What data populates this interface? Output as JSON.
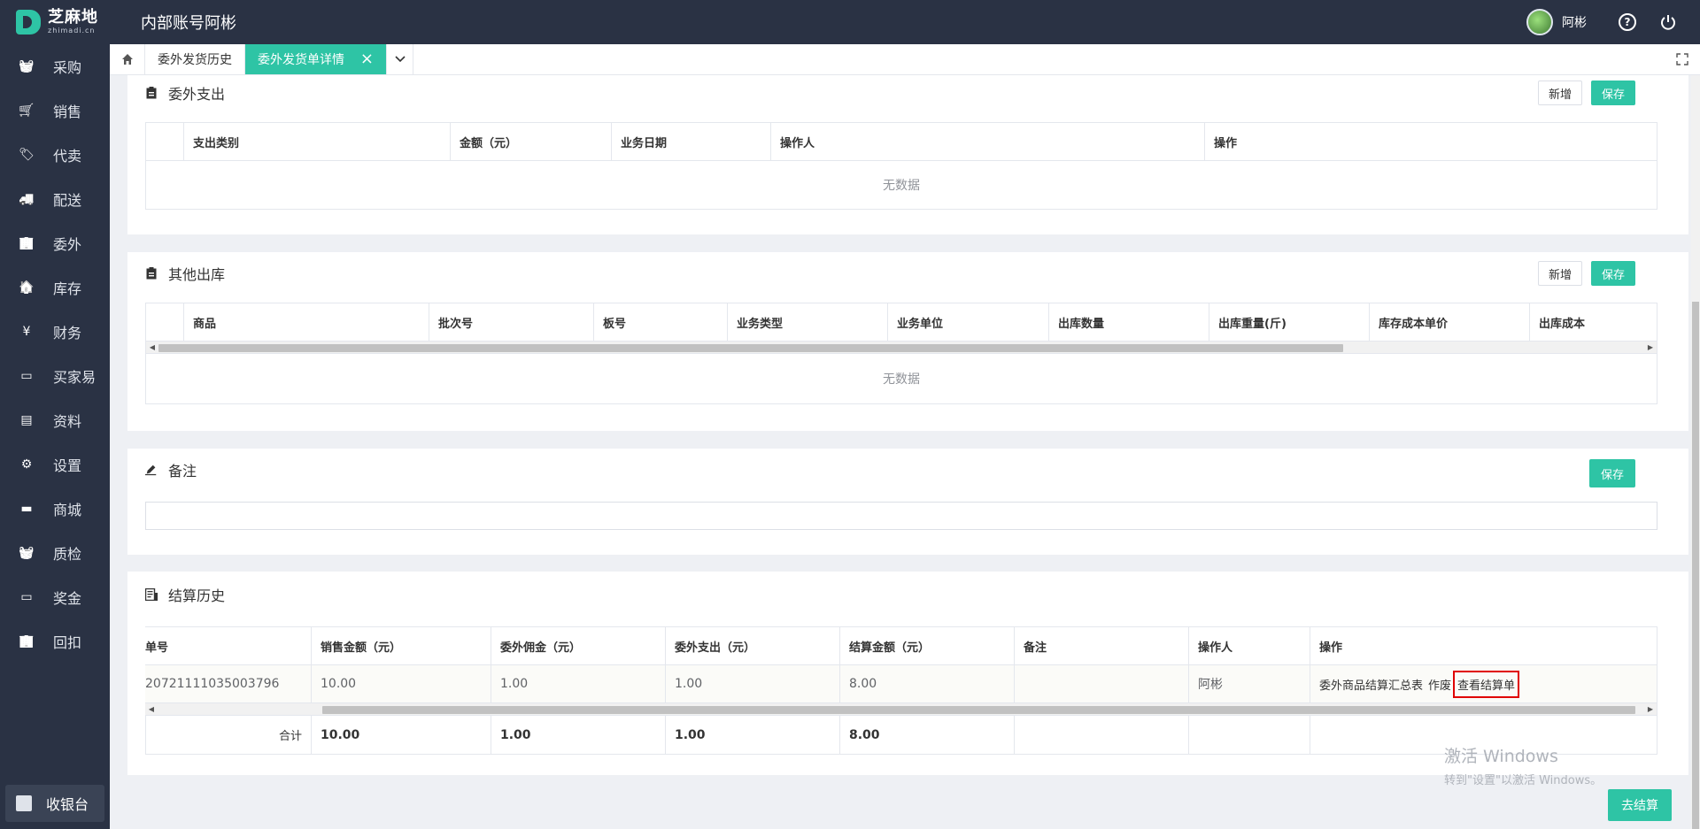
{
  "header": {
    "brand_cn": "芝麻地",
    "brand_en": "zhimadi.cn",
    "app_title": "内部账号阿彬",
    "username": "阿彬"
  },
  "sidebar": {
    "items": [
      {
        "label": "采购",
        "icon": "basket-icon"
      },
      {
        "label": "销售",
        "icon": "cart-icon"
      },
      {
        "label": "代卖",
        "icon": "tag-icon"
      },
      {
        "label": "配送",
        "icon": "truck-icon"
      },
      {
        "label": "委外",
        "icon": "building-icon"
      },
      {
        "label": "库存",
        "icon": "warehouse-icon"
      },
      {
        "label": "财务",
        "icon": "yen-icon"
      },
      {
        "label": "买家易",
        "icon": "store-icon"
      },
      {
        "label": "资料",
        "icon": "printer-icon"
      },
      {
        "label": "设置",
        "icon": "gear-icon"
      },
      {
        "label": "商城",
        "icon": "shop-icon"
      },
      {
        "label": "质检",
        "icon": "basket-check-icon"
      },
      {
        "label": "奖金",
        "icon": "wallet-icon"
      },
      {
        "label": "回扣",
        "icon": "building-return-icon"
      }
    ],
    "cashier": "收银台"
  },
  "tabs": {
    "items": [
      "委外发货历史",
      "委外发货单详情"
    ],
    "active_index": 1
  },
  "outsourcing_expense": {
    "title": "委外支出",
    "add_label": "新增",
    "save_label": "保存",
    "columns": [
      "",
      "支出类别",
      "金额（元）",
      "业务日期",
      "操作人",
      "操作"
    ],
    "empty_text": "无数据"
  },
  "other_outbound": {
    "title": "其他出库",
    "add_label": "新增",
    "save_label": "保存",
    "columns": [
      "",
      "商品",
      "批次号",
      "板号",
      "业务类型",
      "业务单位",
      "出库数量",
      "出库重量(斤)",
      "库存成本单价",
      "出库成本"
    ],
    "empty_text": "无数据"
  },
  "remark": {
    "title": "备注",
    "save_label": "保存",
    "value": ""
  },
  "settlement_history": {
    "title": "结算历史",
    "columns": [
      "单号",
      "销售金额（元）",
      "委外佣金（元）",
      "委外支出（元）",
      "结算金额（元）",
      "备注",
      "操作人",
      "操作"
    ],
    "rows": [
      {
        "order_no": "20721111035003796",
        "sales_amount": "10.00",
        "commission": "1.00",
        "expense": "1.00",
        "settlement_amount": "8.00",
        "note": "",
        "operator": "阿彬",
        "op_summary": "委外商品结算汇总表",
        "op_void": "作废",
        "op_view": "查看结算单"
      }
    ],
    "sum": {
      "label": "合计",
      "sales_amount": "10.00",
      "commission": "1.00",
      "expense": "1.00",
      "settlement_amount": "8.00"
    }
  },
  "watermark": {
    "line1": "激活 Windows",
    "line2": "转到\"设置\"以激活 Windows。"
  },
  "footer": {
    "settle_label": "去结算"
  },
  "colors": {
    "accent": "#2ec4a5",
    "sidebar_bg": "#2a3244",
    "highlight_border": "#e00000"
  }
}
